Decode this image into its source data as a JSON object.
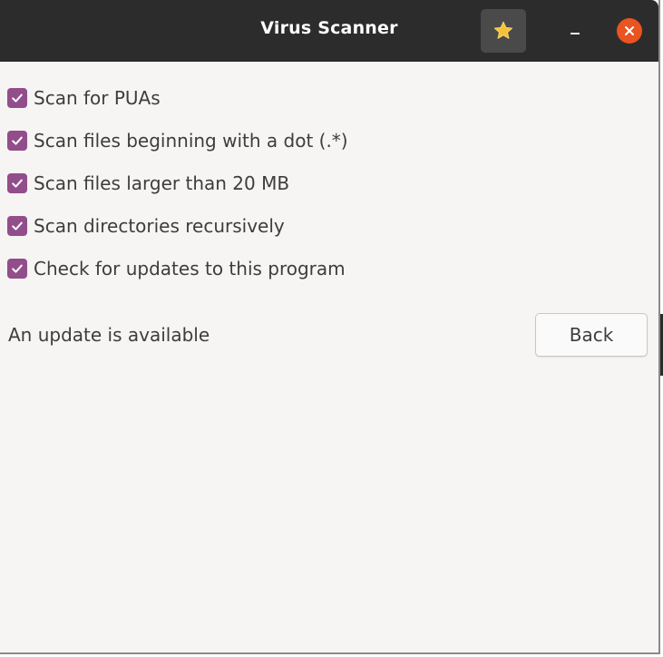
{
  "window": {
    "title": "Virus Scanner",
    "title_bar_color": "#2c2c2c",
    "accent_color": "#924d8b",
    "close_color": "#e95420"
  },
  "titlebar_buttons": {
    "star_icon": "star-icon",
    "minimize_icon": "minimize-icon",
    "close_icon": "close-icon"
  },
  "options": [
    {
      "label": "Scan for PUAs",
      "checked": true
    },
    {
      "label": "Scan files beginning with a dot (.*)",
      "checked": true
    },
    {
      "label": "Scan files larger than 20 MB",
      "checked": true
    },
    {
      "label": "Scan directories recursively",
      "checked": true
    },
    {
      "label": "Check for updates to this program",
      "checked": true
    }
  ],
  "status": {
    "text": "An update is available"
  },
  "actions": {
    "back_label": "Back"
  }
}
